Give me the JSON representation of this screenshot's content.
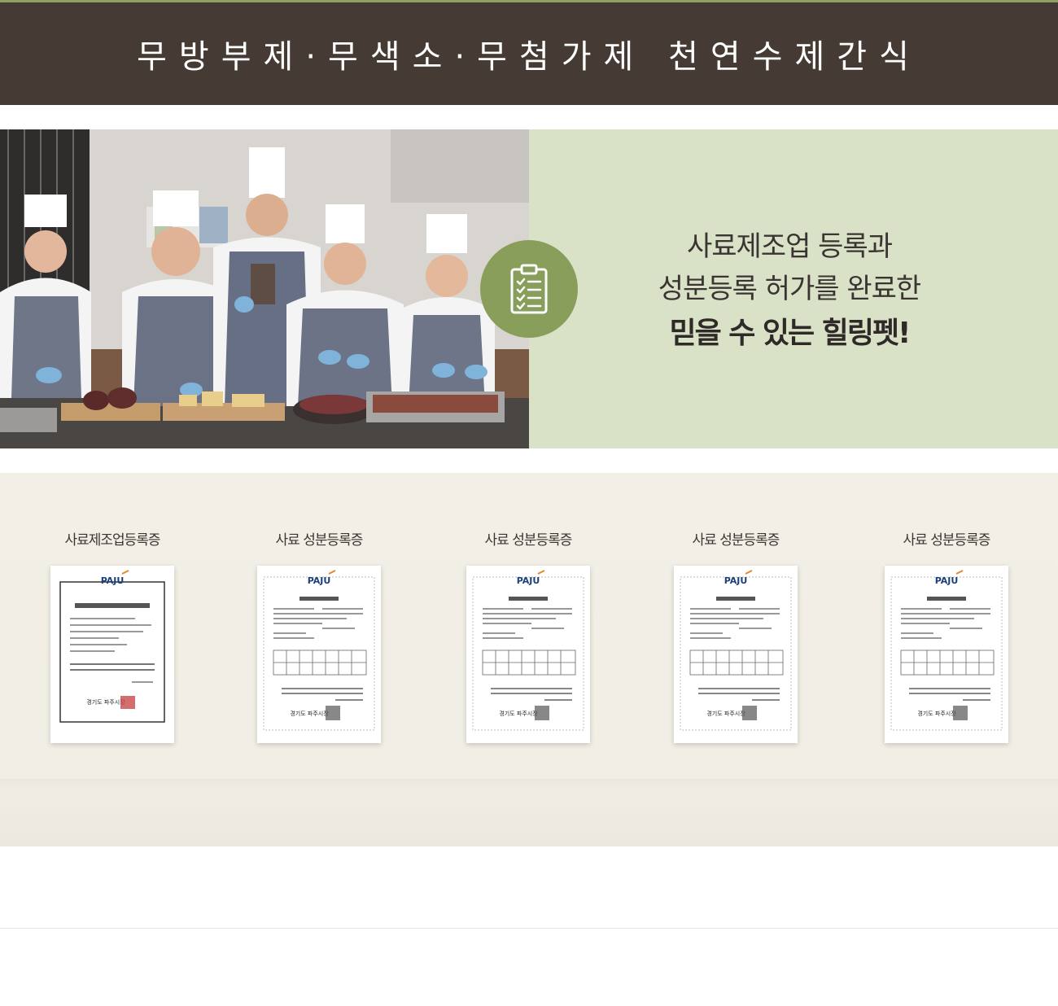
{
  "banner": {
    "title": "무방부제·무색소·무첨가제  천연수제간식"
  },
  "feature": {
    "photo_label": "team-kitchen-photo",
    "badge_icon": "clipboard-checklist-icon",
    "line1": "사료제조업 등록과",
    "line2": "성분등록 허가를 완료한",
    "line3": "믿을 수 있는 힐링펫!",
    "accent_color": "#8a9e5b"
  },
  "certificates": [
    {
      "title": "사료제조업등록증",
      "logo": "PAJU",
      "issuer": "경기도 파주시장"
    },
    {
      "title": "사료 성분등록증",
      "logo": "PAJU",
      "issuer": "경기도 파주시장"
    },
    {
      "title": "사료 성분등록증",
      "logo": "PAJU",
      "issuer": "경기도 파주시장"
    },
    {
      "title": "사료 성분등록증",
      "logo": "PAJU",
      "issuer": "경기도 파주시장"
    },
    {
      "title": "사료 성분등록증",
      "logo": "PAJU",
      "issuer": "경기도 파주시장"
    }
  ],
  "colors": {
    "banner_bg": "#463b34",
    "feature_bg": "#d9e1c7",
    "section_bg": "#f2efe6"
  }
}
